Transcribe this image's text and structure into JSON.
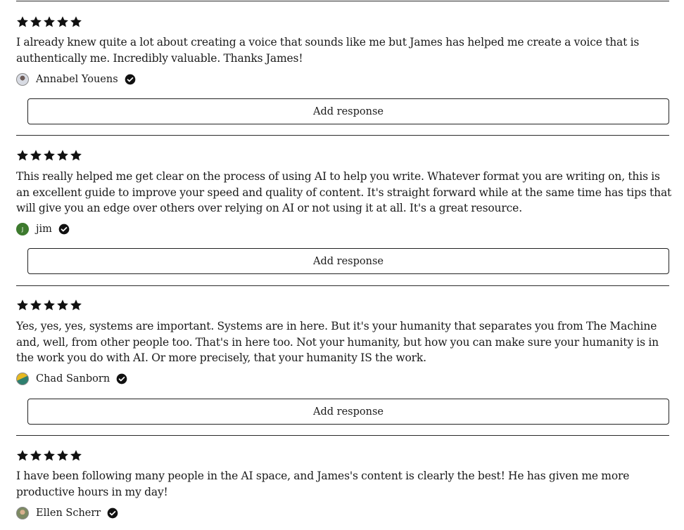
{
  "reviews": [
    {
      "rating": 5,
      "text": "I already knew quite a lot about creating a voice that sounds like me but James has helped me create a voice that is authentically me. Incredibly valuable. Thanks James!",
      "author": "Annabel Youens",
      "avatar": {
        "type": "photo",
        "colors": [
          "#c9ccd6",
          "#6d5c59"
        ]
      },
      "verified": true,
      "response_label": "Add response"
    },
    {
      "rating": 5,
      "text": "This really helped me get clear on the process of using AI to help you write. Whatever format you are writing on, this is an excellent guide to improve your speed and quality of content. It's straight forward while at the same time has tips that will give you an edge over others over relying on AI or not using it at all. It's a great resource.",
      "author": "jim",
      "avatar": {
        "type": "initial",
        "initial": "J",
        "colors": [
          "#3d7a2e"
        ]
      },
      "verified": true,
      "response_label": "Add response"
    },
    {
      "rating": 5,
      "text": "Yes, yes, yes, systems are important. Systems are in here. But it's your humanity that separates you from The Machine and, well, from other people too. That's in here too. Not your humanity, but how you can make sure your humanity is in the work you do with AI. Or more precisely, that your humanity IS the work.",
      "author": "Chad Sanborn",
      "avatar": {
        "type": "photo",
        "colors": [
          "#e6b820",
          "#2e7f6f"
        ]
      },
      "verified": true,
      "response_label": "Add response"
    },
    {
      "rating": 5,
      "text": "I have been following many people in the AI space, and James's content is clearly the best! He has given me more productive hours in my day!",
      "author": "Ellen Scherr",
      "avatar": {
        "type": "photo",
        "colors": [
          "#7d8a63",
          "#d9b08f"
        ]
      },
      "verified": true,
      "response_label": "Add response"
    }
  ],
  "icons": {
    "star": "star-icon",
    "verified": "verified-check-icon"
  },
  "colors": {
    "star": "#111111",
    "verified_badge": "#111111",
    "text": "#1a1a1a",
    "divider": "#2a2a2a"
  }
}
